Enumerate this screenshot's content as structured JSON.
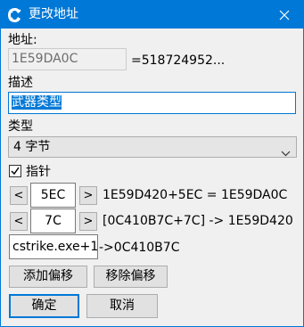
{
  "window": {
    "title": "更改地址"
  },
  "address": {
    "label": "地址:",
    "value": "1E59DA0C",
    "resolved": "=518724952..."
  },
  "description": {
    "label": "描述",
    "value": "武器类型"
  },
  "type": {
    "label": "类型",
    "selected": "4 字节"
  },
  "pointer": {
    "checked": true,
    "label": "指针"
  },
  "offsets": [
    {
      "dec": "<",
      "value": "5EC",
      "inc": ">",
      "result": "1E59D420+5EC = 1E59DA0C"
    },
    {
      "dec": "<",
      "value": "7C",
      "inc": ">",
      "result": "[0C410B7C+7C] -> 1E59D420"
    }
  ],
  "base": {
    "value": "cstrike.exe+1",
    "result": "->0C410B7C"
  },
  "buttons": {
    "add_offset": "添加偏移",
    "remove_offset": "移除偏移",
    "ok": "确定",
    "cancel": "取消"
  }
}
